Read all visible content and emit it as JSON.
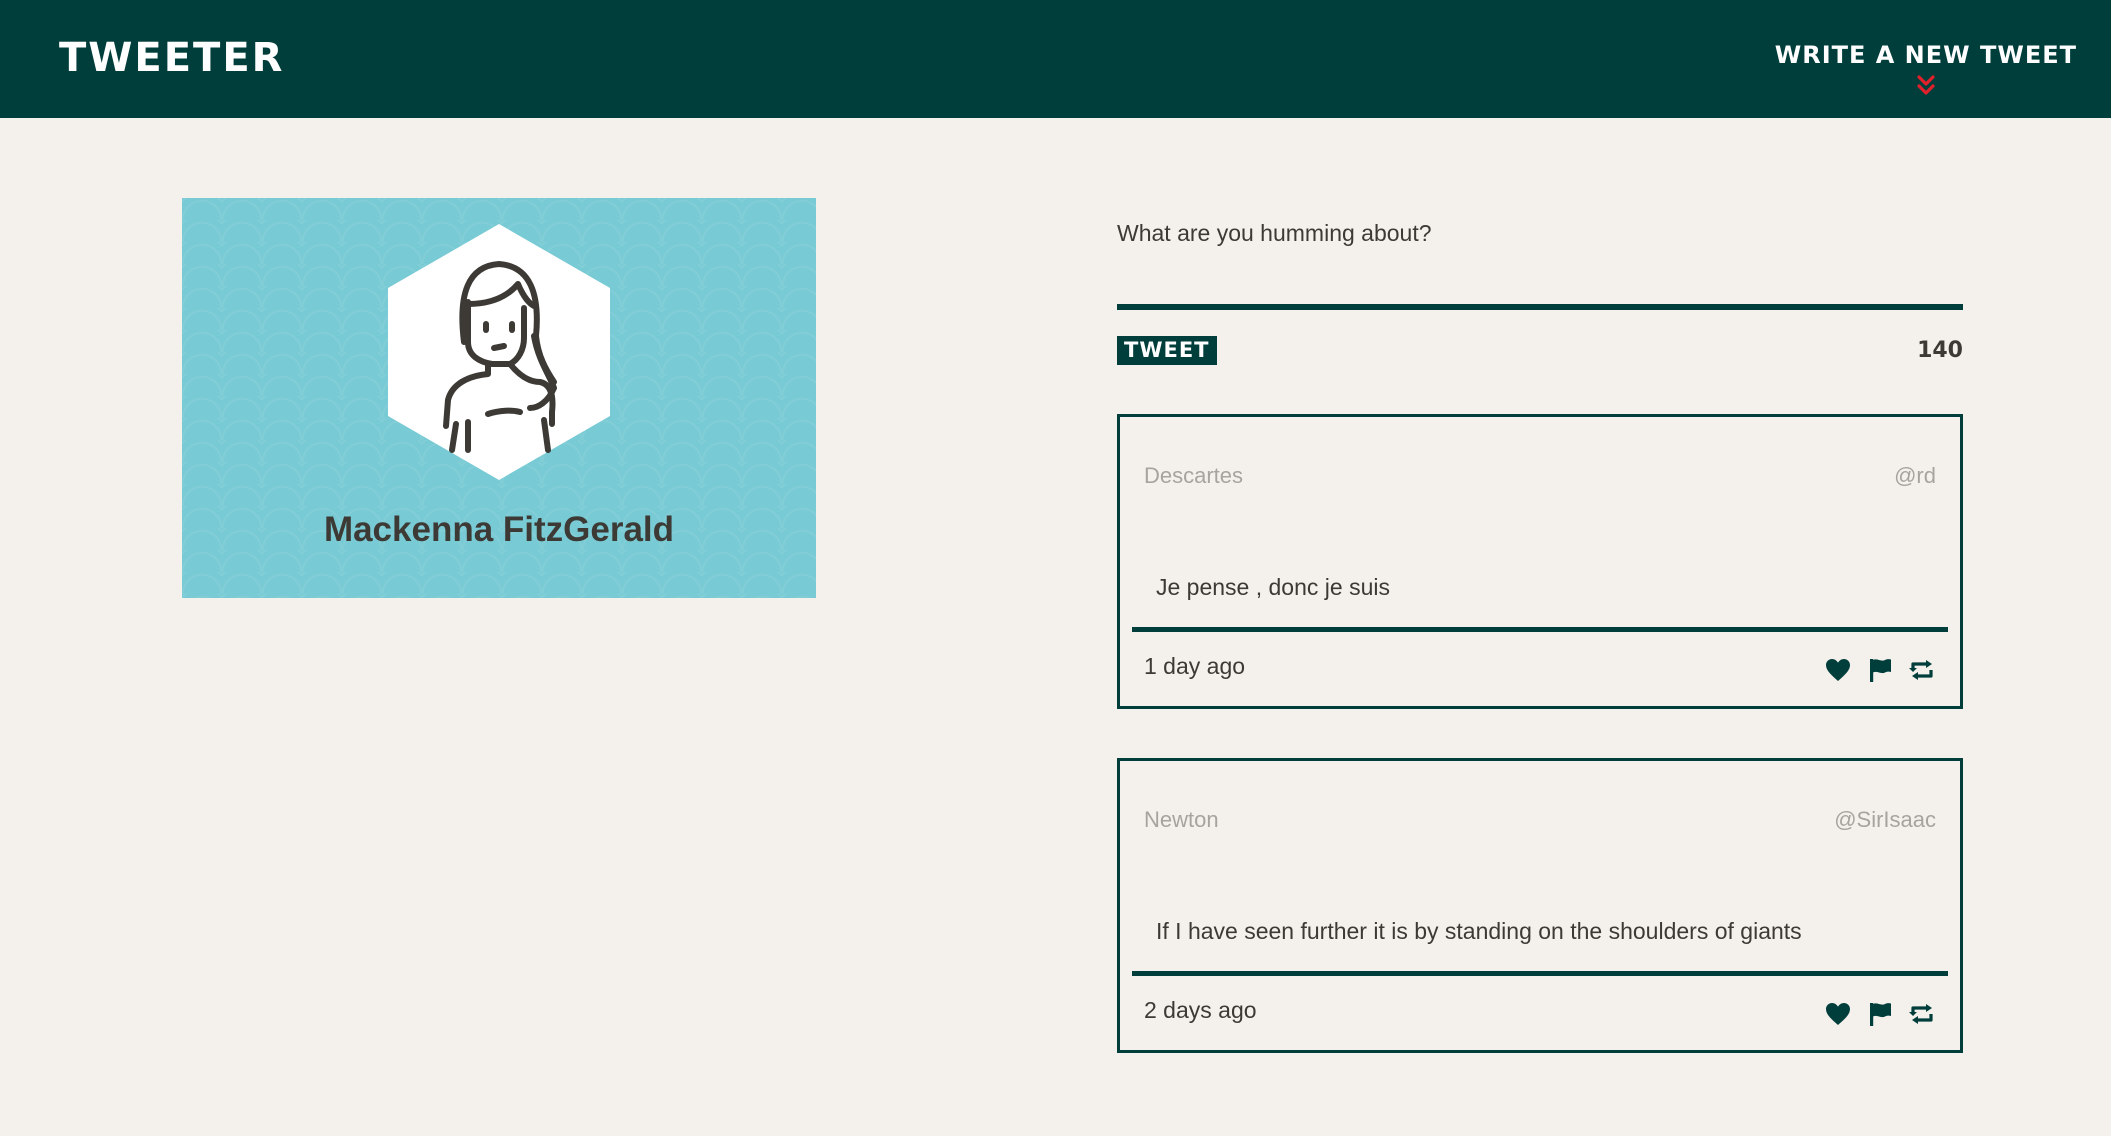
{
  "header": {
    "brand": "TWEETER",
    "compose_toggle_label": "WRITE A NEW TWEET",
    "compose_toggle_icon": "chevron-double-down-icon",
    "background_color": "#003e3c",
    "chevron_color": "#e0202a"
  },
  "profile": {
    "name": "Mackenna FitzGerald",
    "avatar_icon": "person-hexagon-avatar",
    "card_color": "#78cad4"
  },
  "compose": {
    "placeholder": "What are you humming about?",
    "value": "",
    "submit_label": "TWEET",
    "char_count": "140"
  },
  "tweets": [
    {
      "author": "Descartes",
      "handle": "@rd",
      "text": "Je pense , donc je suis",
      "time": "1 day ago"
    },
    {
      "author": "Newton",
      "handle": "@SirIsaac",
      "text": "If I have seen further it is by standing on the shoulders of giants",
      "time": "2 days ago"
    }
  ],
  "tweet_actions": [
    "heart-icon",
    "flag-icon",
    "retweet-icon"
  ]
}
